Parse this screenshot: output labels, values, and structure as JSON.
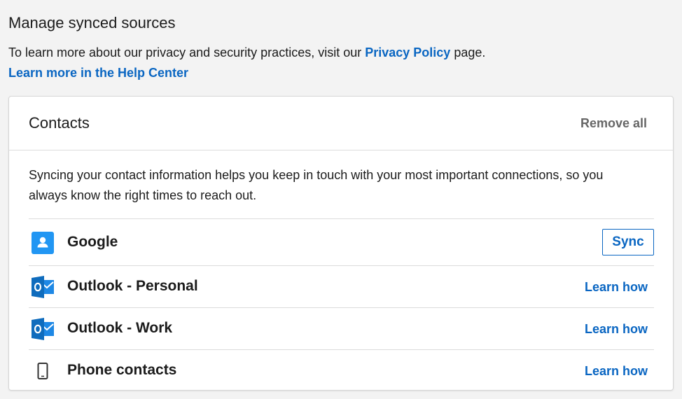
{
  "page": {
    "title": "Manage synced sources",
    "intro_prefix": "To learn more about our privacy and security practices, visit our ",
    "privacy_link": "Privacy Policy",
    "intro_suffix": " page.",
    "help_link": "Learn more in the Help Center"
  },
  "contacts_card": {
    "title": "Contacts",
    "remove_all": "Remove all",
    "description": "Syncing your contact information helps you keep in touch with your most important connections, so you always know the right times to reach out.",
    "sources": [
      {
        "name": "Google",
        "icon": "google-contacts-icon",
        "action": "Sync"
      },
      {
        "name": "Outlook - Personal",
        "icon": "outlook-icon",
        "action": "Learn how"
      },
      {
        "name": "Outlook - Work",
        "icon": "outlook-icon",
        "action": "Learn how"
      },
      {
        "name": "Phone contacts",
        "icon": "phone-icon",
        "action": "Learn how"
      }
    ]
  },
  "colors": {
    "background": "#f3f3f3",
    "link_blue": "#0a66c2",
    "google_blue": "#2196f3",
    "outlook_blue": "#0f6cbd",
    "muted_text": "#666666"
  }
}
